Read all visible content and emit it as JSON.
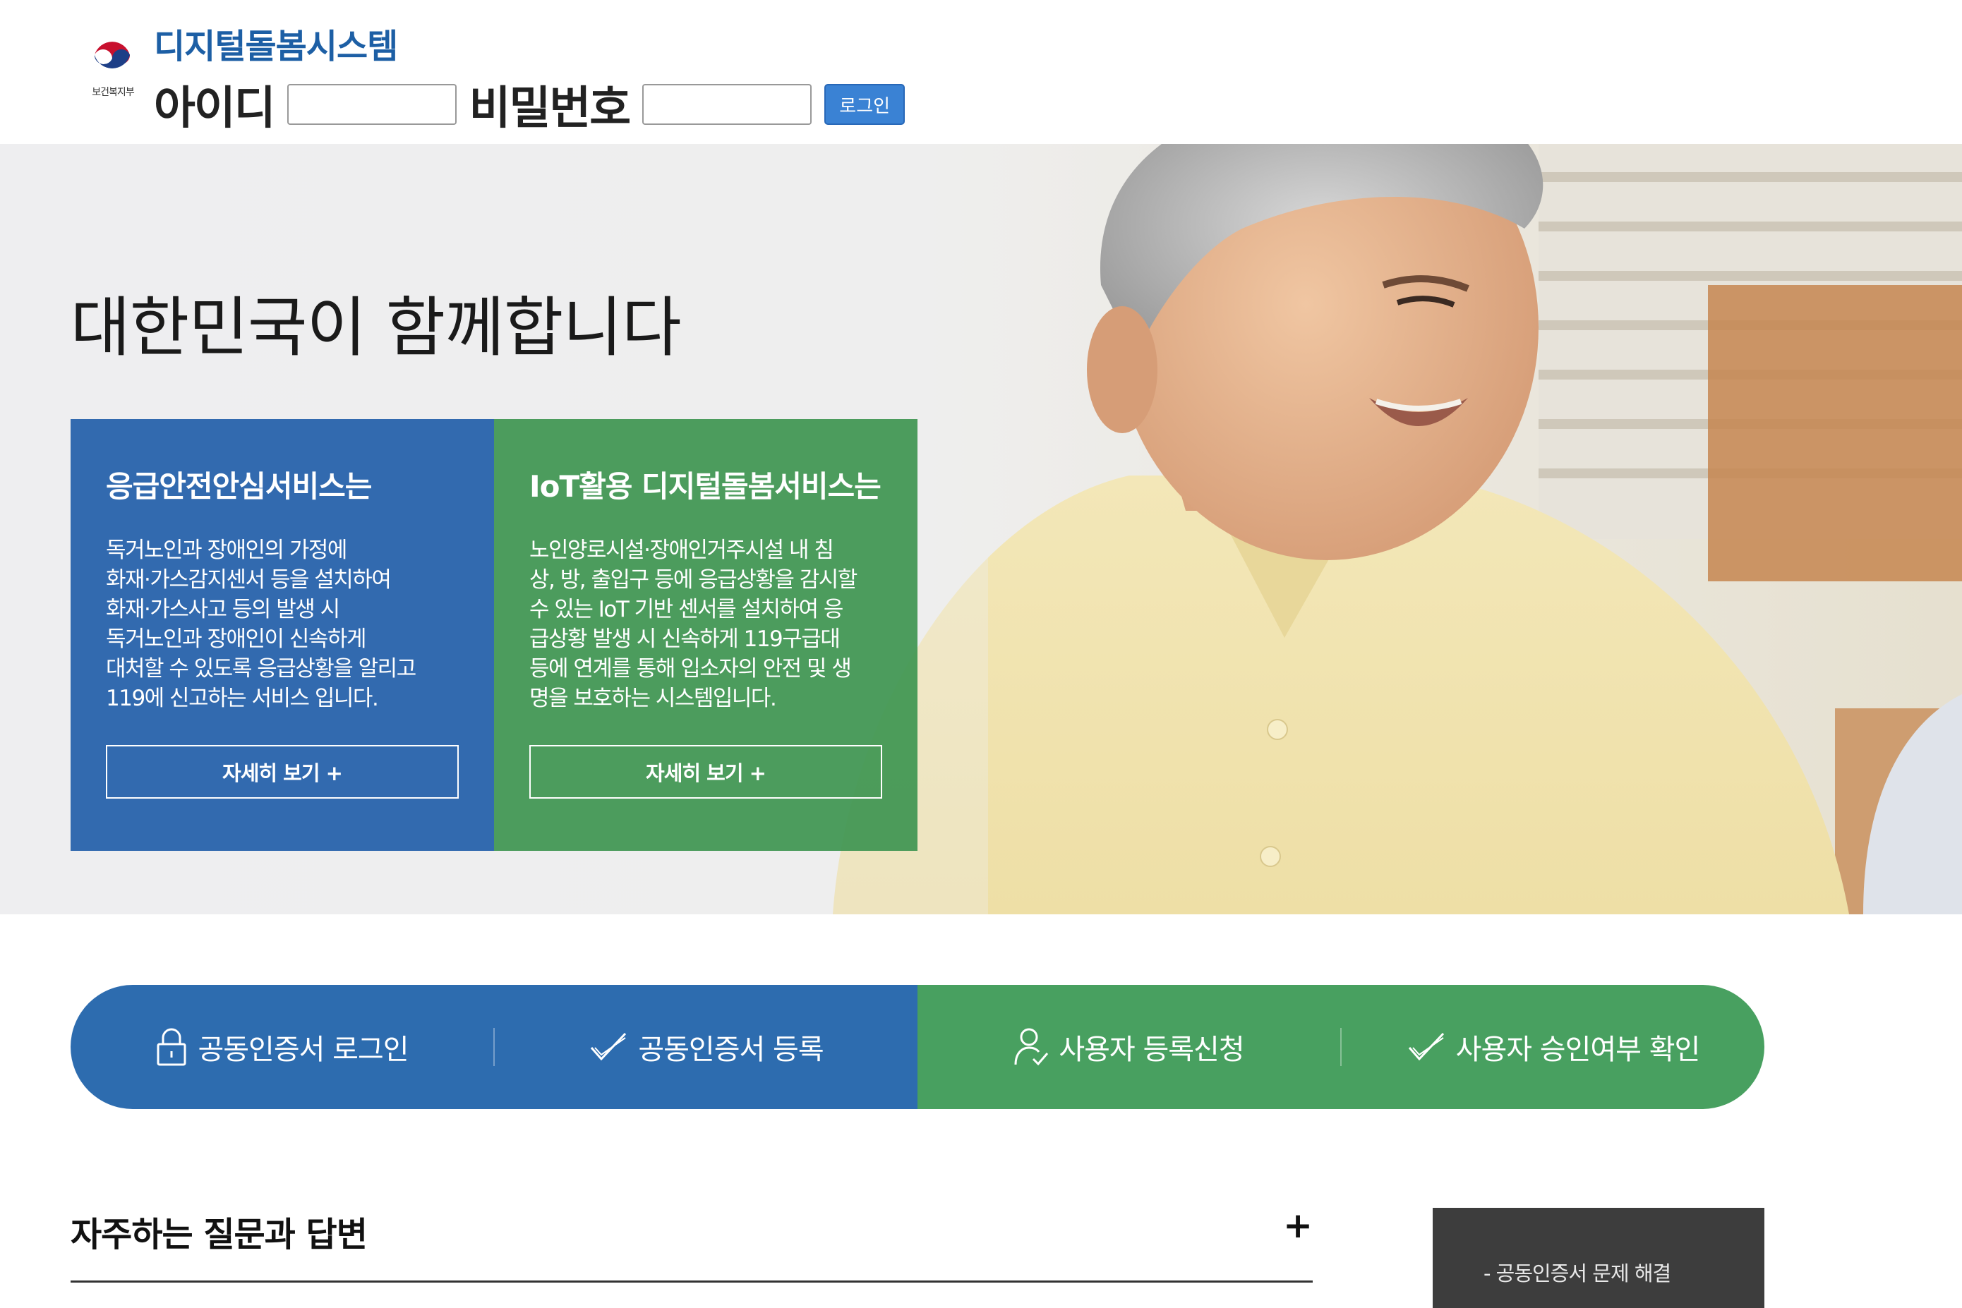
{
  "header": {
    "ministry_logo_text": "보건복지부",
    "site_title": "디지털돌봄시스템",
    "id_label": "아이디",
    "password_label": "비밀번호",
    "id_value": "",
    "password_value": "",
    "login_button": "로그인"
  },
  "hero": {
    "headline": "대한민국이 함께합니다",
    "cards": [
      {
        "title": "응급안전안심서비스는",
        "body_lines": [
          "독거노인과 장애인의 가정에",
          "화재·가스감지센서 등을 설치하여",
          "화재·가스사고 등의 발생 시",
          "독거노인과 장애인이 신속하게",
          "대처할 수 있도록 응급상황을 알리고",
          "119에 신고하는 서비스 입니다."
        ],
        "button": "자세히 보기 +",
        "color": "#2360aa"
      },
      {
        "title": "IoT활용 디지털돌봄서비스는",
        "body_lines": [
          "노인양로시설·장애인거주시설 내 침",
          "상, 방, 출입구 등에 응급상황을 감시할",
          "수 있는 IoT 기반 센서를 설치하여 응",
          "급상황 발생 시 신속하게 119구급대",
          "등에 연계를 통해 입소자의 안전 및 생",
          "명을 보호하는 시스템입니다."
        ],
        "button": "자세히 보기 +",
        "color": "#409652"
      }
    ]
  },
  "quick_menu": {
    "items": [
      {
        "label": "공동인증서 로그인",
        "icon": "lock-icon"
      },
      {
        "label": "공동인증서 등록",
        "icon": "check-icon"
      },
      {
        "label": "사용자 등록신청",
        "icon": "user-check-icon"
      },
      {
        "label": "사용자 승인여부 확인",
        "icon": "check-icon"
      }
    ],
    "colors": {
      "blue": "#2d6caf",
      "green": "#48a060"
    }
  },
  "faq": {
    "title": "자주하는 질문과 답변",
    "expand": "+"
  },
  "side_box": {
    "link": "- 공동인증서 문제 해결"
  }
}
